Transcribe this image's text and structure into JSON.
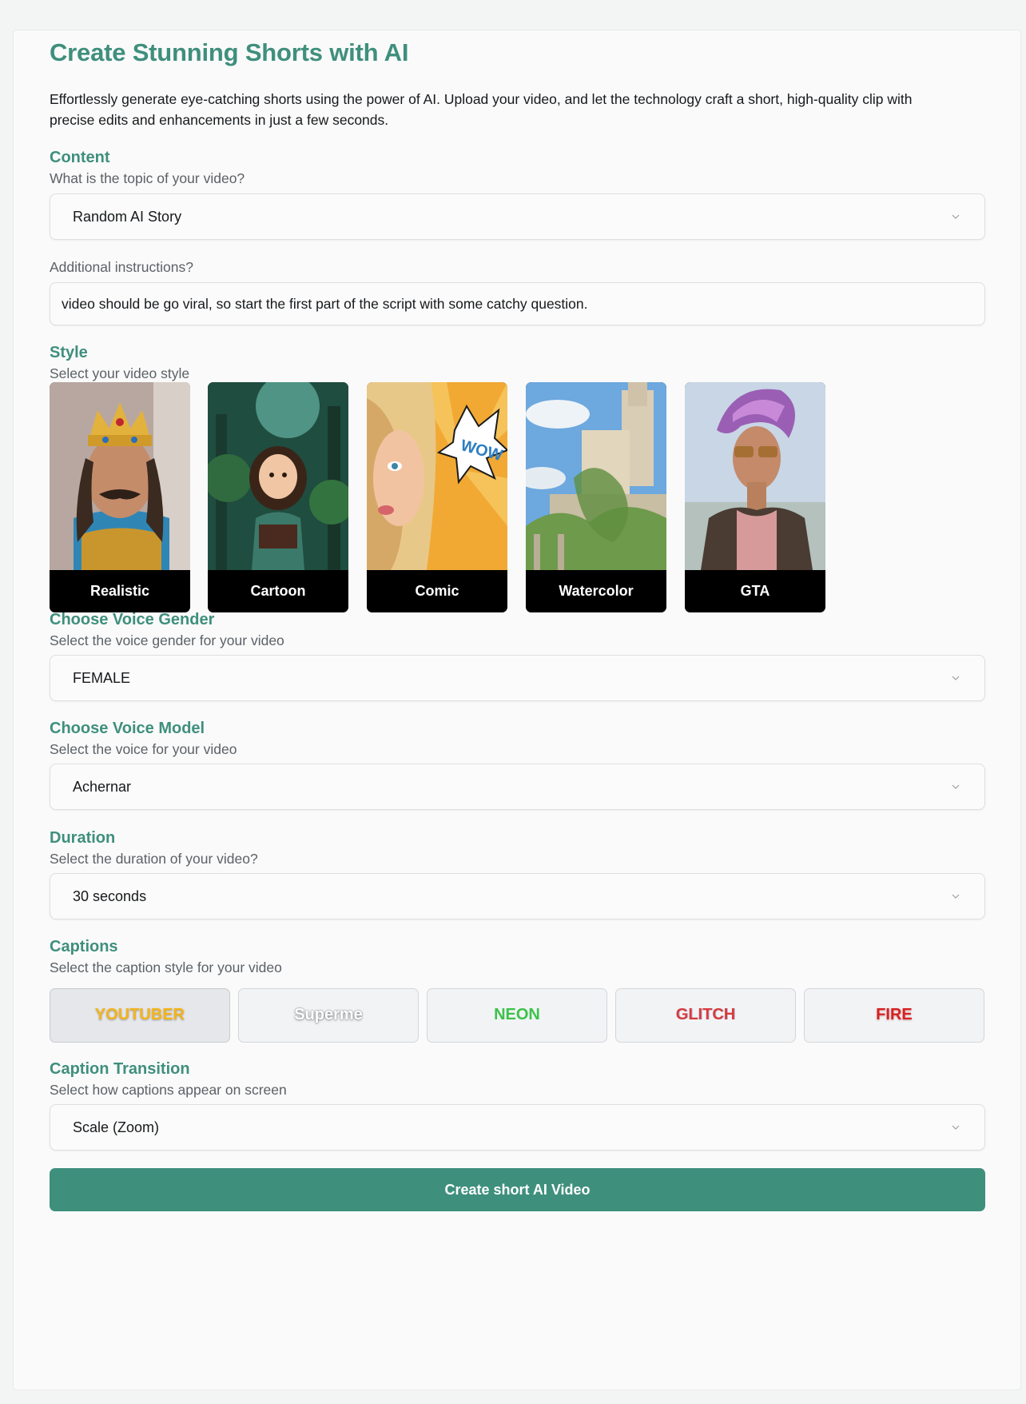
{
  "header": {
    "title": "Create Stunning Shorts with AI",
    "description": "Effortlessly generate eye-catching shorts using the power of AI. Upload your video, and let the technology craft a short, high-quality clip with precise edits and enhancements in just a few seconds."
  },
  "content": {
    "title": "Content",
    "subtitle": "What is the topic of your video?",
    "topic_value": "Random AI Story",
    "instructions_label": "Additional instructions?",
    "instructions_value": "video should be go viral, so start the first part of the script with some catchy question."
  },
  "style": {
    "title": "Style",
    "subtitle": "Select your video style",
    "options": [
      {
        "label": "Realistic"
      },
      {
        "label": "Cartoon"
      },
      {
        "label": "Comic"
      },
      {
        "label": "Watercolor"
      },
      {
        "label": "GTA"
      }
    ]
  },
  "voice_gender": {
    "title": "Choose Voice Gender",
    "subtitle": "Select the voice gender for your video",
    "value": "FEMALE"
  },
  "voice_model": {
    "title": "Choose Voice Model",
    "subtitle": "Select the voice for your video",
    "value": "Achernar"
  },
  "duration": {
    "title": "Duration",
    "subtitle": "Select the duration of your video?",
    "value": "30 seconds"
  },
  "captions": {
    "title": "Captions",
    "subtitle": "Select the caption style for your video",
    "options": [
      {
        "label": "YOUTUBER",
        "color": "#f4b41a",
        "selected": true
      },
      {
        "label": "Superme",
        "color": "#ffffff",
        "selected": false
      },
      {
        "label": "NEON",
        "color": "#3cc24a",
        "selected": false
      },
      {
        "label": "GLITCH",
        "color": "#d93b3b",
        "selected": false
      },
      {
        "label": "FIRE",
        "color": "#d82020",
        "selected": false
      }
    ]
  },
  "caption_transition": {
    "title": "Caption Transition",
    "subtitle": "Select how captions appear on screen",
    "value": "Scale (Zoom)"
  },
  "submit": {
    "label": "Create short AI Video"
  },
  "colors": {
    "accent": "#3f8f7d"
  }
}
